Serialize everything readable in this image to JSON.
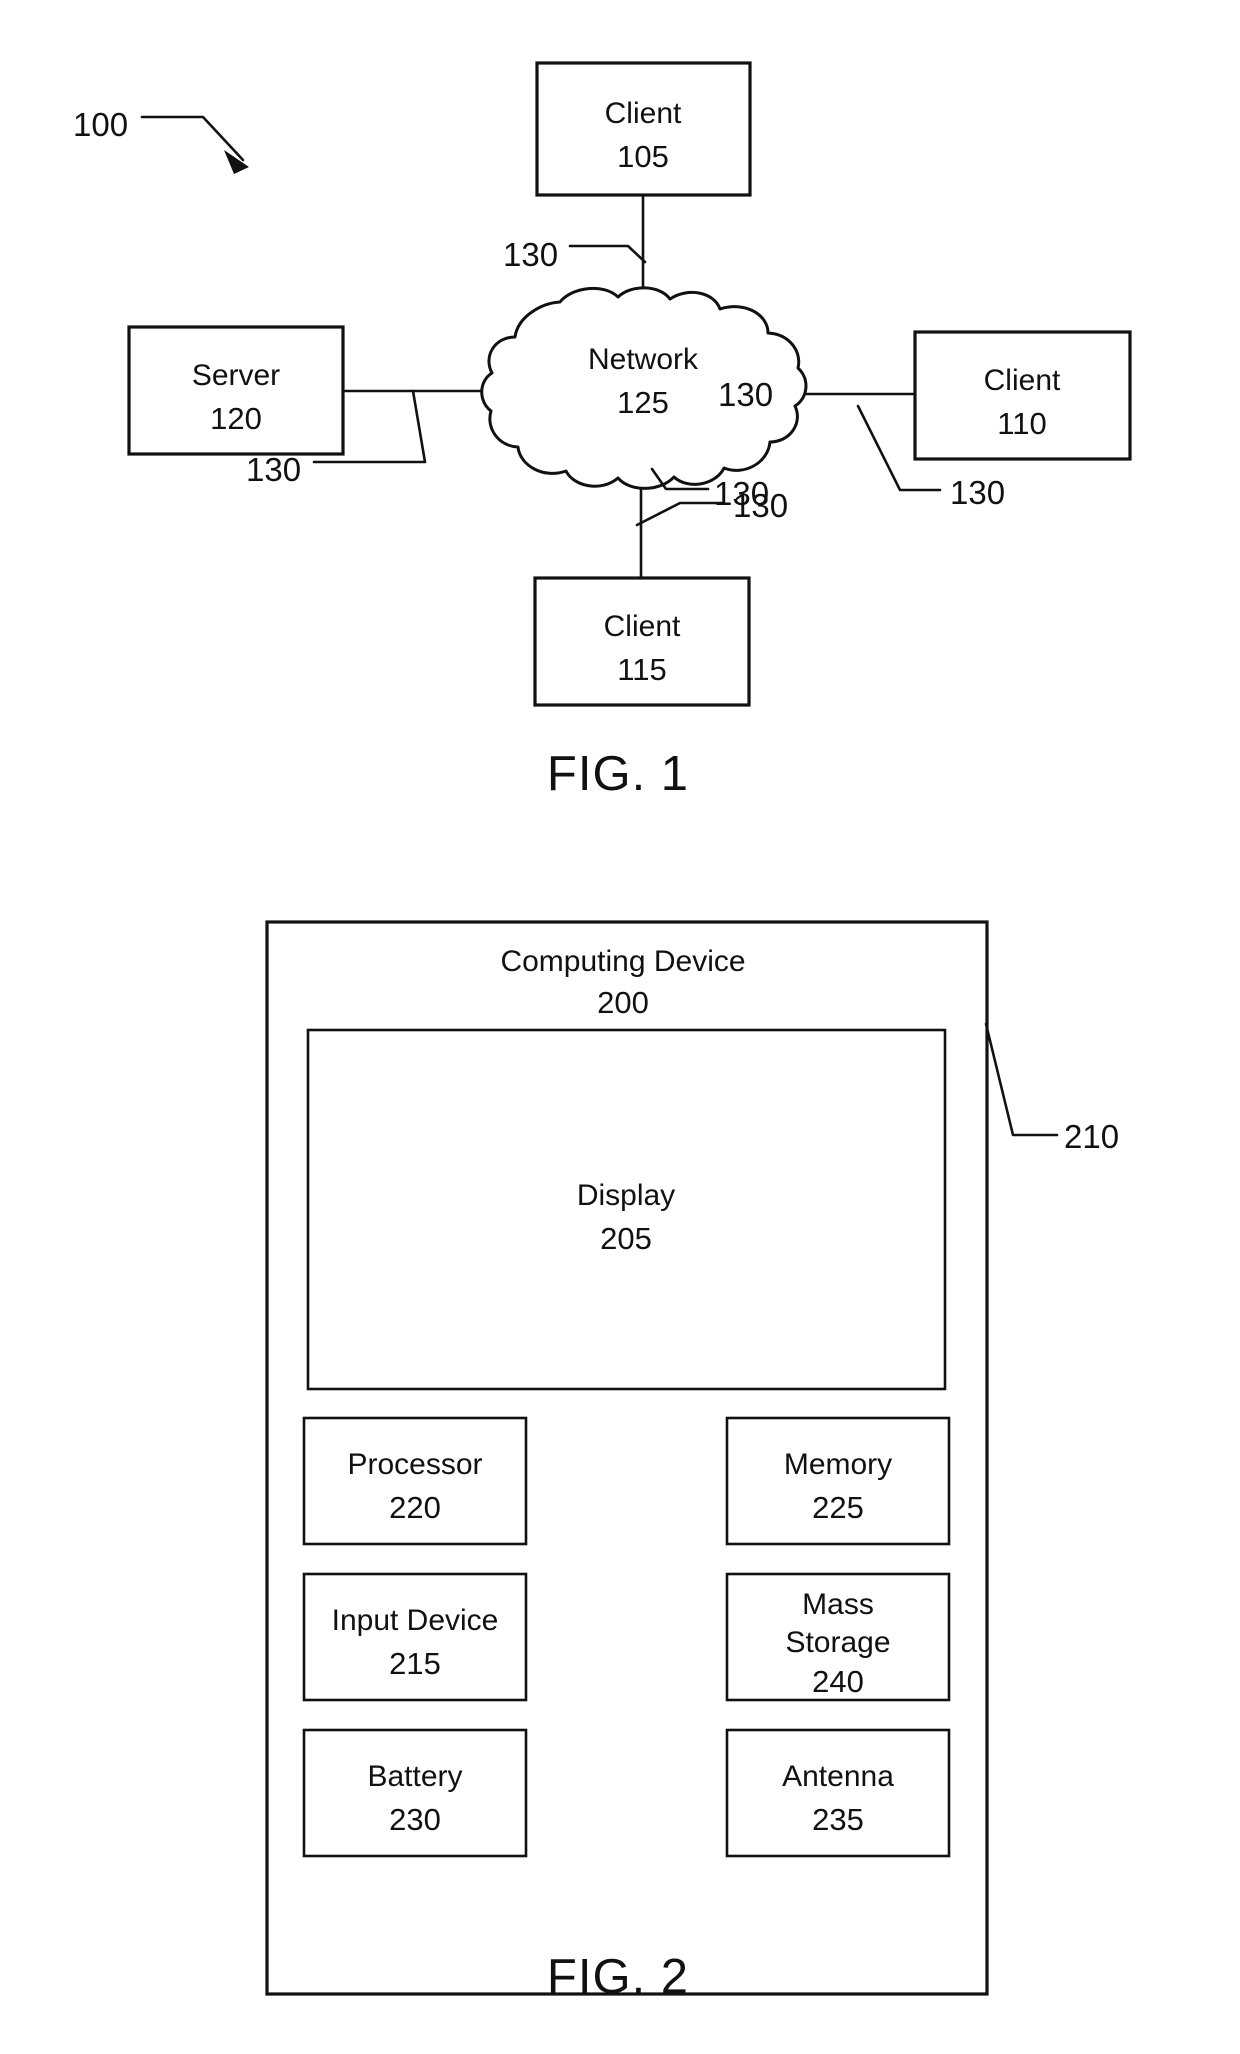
{
  "document": {
    "kind": "patent-drawing-sheet",
    "figures": [
      "FIG. 1",
      "FIG. 2"
    ]
  },
  "figure1": {
    "caption": "FIG. 1",
    "system_ref": "100",
    "nodes": {
      "client105": {
        "label": "Client",
        "ref": "105"
      },
      "client110": {
        "label": "Client",
        "ref": "110"
      },
      "client115": {
        "label": "Client",
        "ref": "115"
      },
      "server120": {
        "label": "Server",
        "ref": "120"
      },
      "network125": {
        "label": "Network",
        "ref": "125"
      }
    },
    "link_refs": {
      "top": "130",
      "left": "130",
      "right": "130",
      "bottom": "130"
    }
  },
  "figure2": {
    "caption": "FIG. 2",
    "device": {
      "label": "Computing Device",
      "ref": "200"
    },
    "bus_ref": "210",
    "display": {
      "label": "Display",
      "ref": "205"
    },
    "components": [
      {
        "label": "Processor",
        "ref": "220"
      },
      {
        "label": "Memory",
        "ref": "225"
      },
      {
        "label": "Input Device",
        "ref": "215"
      },
      {
        "label_line1": "Mass",
        "label_line2": "Storage",
        "ref": "240"
      },
      {
        "label": "Battery",
        "ref": "230"
      },
      {
        "label": "Antenna",
        "ref": "235"
      }
    ]
  },
  "colors": {
    "ink": "#111111",
    "paper": "#ffffff"
  }
}
